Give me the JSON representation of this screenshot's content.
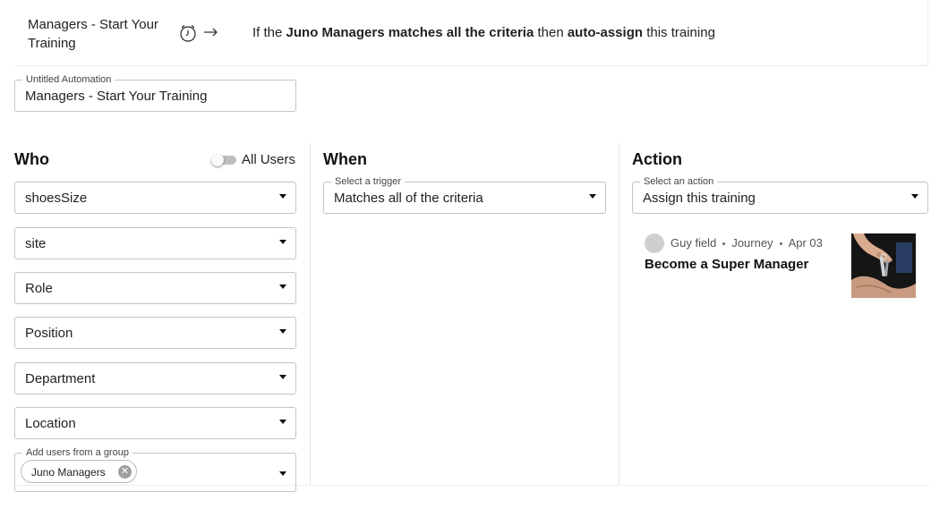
{
  "summary": {
    "automation_name": "Managers - Start Your Training",
    "icons": [
      "alarm-clock-icon",
      "arrow-right-icon"
    ],
    "rule_prefix": "If the ",
    "rule_subject": "Juno Managers matches all the criteria",
    "rule_middle": " then ",
    "rule_action": "auto-assign",
    "rule_suffix": " this training"
  },
  "name_field": {
    "label": "Untitled Automation",
    "value": "Managers - Start Your Training"
  },
  "who": {
    "title": "Who",
    "toggle_label": "All Users",
    "toggle_on": false,
    "filters": [
      "shoesSize",
      "site",
      "Role",
      "Position",
      "Department",
      "Location"
    ],
    "group_field": {
      "label": "Add users from a group",
      "chips": [
        "Juno Managers"
      ]
    }
  },
  "when": {
    "title": "When",
    "trigger_label": "Select a trigger",
    "trigger_value": "Matches all of the criteria"
  },
  "action": {
    "title": "Action",
    "action_label": "Select an action",
    "action_value": "Assign this training",
    "training": {
      "author": "Guy field",
      "type": "Journey",
      "date": "Apr 03",
      "title": "Become a Super Manager",
      "thumbnail": "hand-holding-keys-image"
    }
  },
  "colors": {
    "border": "#c4c4c4",
    "divider": "#e6e6e6",
    "text": "#1f1f1f"
  }
}
